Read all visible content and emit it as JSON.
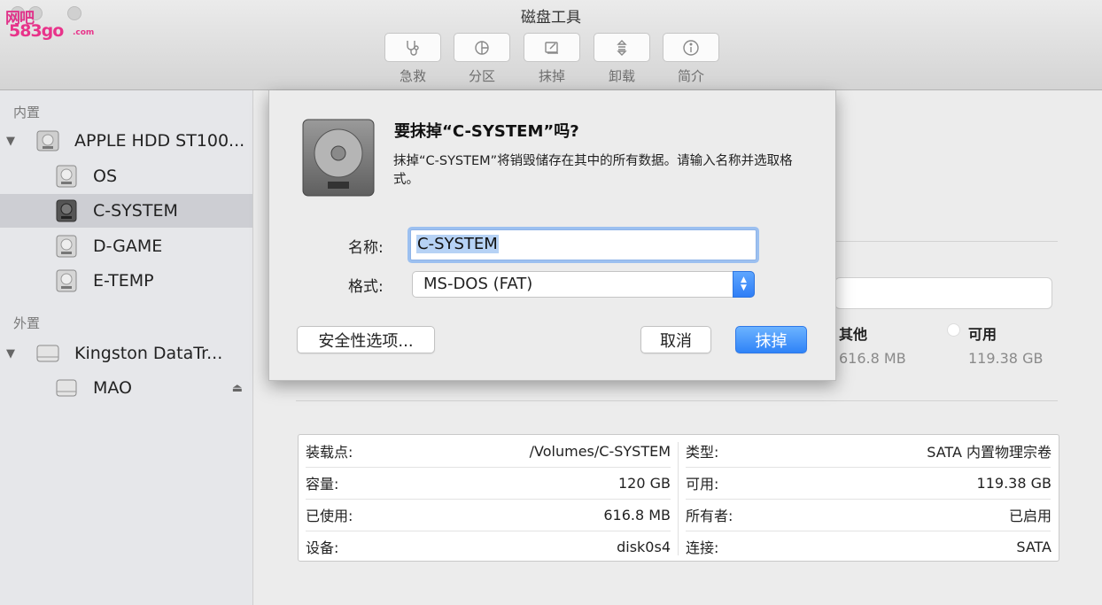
{
  "window": {
    "title": "磁盘工具",
    "watermark": {
      "line1": "网吧",
      "line2": "583go",
      "line3": ".com"
    }
  },
  "toolbar": {
    "items": [
      {
        "label": "急救",
        "icon": "stethoscope-icon"
      },
      {
        "label": "分区",
        "icon": "pie-chart-icon"
      },
      {
        "label": "抹掉",
        "icon": "erase-icon"
      },
      {
        "label": "卸载",
        "icon": "unmount-icon"
      },
      {
        "label": "简介",
        "icon": "info-icon"
      }
    ]
  },
  "sidebar": {
    "internal_label": "内置",
    "external_label": "外置",
    "internal_disk": "APPLE HDD ST100...",
    "internal_volumes": [
      "OS",
      "C-SYSTEM",
      "D-GAME",
      "E-TEMP"
    ],
    "selected": "C-SYSTEM",
    "external_disk": "Kingston DataTr...",
    "external_volumes": [
      "MAO"
    ],
    "eject_glyph": "⏏",
    "expand_glyph": "▼"
  },
  "dialog": {
    "title": "要抹掉“C-SYSTEM”吗?",
    "message": "抹掉“C-SYSTEM”将销毁储存在其中的所有数据。请输入名称并选取格式。",
    "name_label": "名称:",
    "name_value": "C-SYSTEM",
    "format_label": "格式:",
    "format_value": "MS-DOS (FAT)",
    "security_button": "安全性选项...",
    "cancel_button": "取消",
    "erase_button": "抹掉"
  },
  "usage": {
    "other_label": "其他",
    "other_value": "616.8 MB",
    "available_label": "可用",
    "available_value": "119.38 GB"
  },
  "info": {
    "left": [
      {
        "k": "装载点:",
        "v": "/Volumes/C-SYSTEM"
      },
      {
        "k": "容量:",
        "v": "120 GB"
      },
      {
        "k": "已使用:",
        "v": "616.8 MB"
      },
      {
        "k": "设备:",
        "v": "disk0s4"
      }
    ],
    "right": [
      {
        "k": "类型:",
        "v": "SATA 内置物理宗卷"
      },
      {
        "k": "可用:",
        "v": "119.38 GB"
      },
      {
        "k": "所有者:",
        "v": "已启用"
      },
      {
        "k": "连接:",
        "v": "SATA"
      }
    ]
  },
  "colors": {
    "accent": "#3a86f5",
    "selection": "#cdced3",
    "sidebar": "#e6e7ea"
  }
}
